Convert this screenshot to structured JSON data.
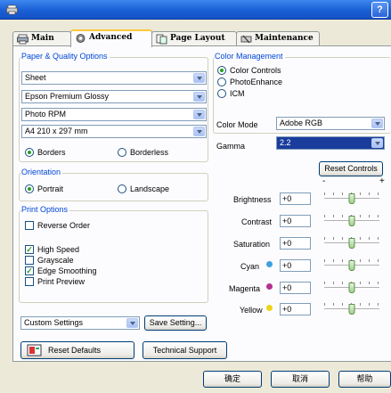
{
  "window": {
    "help_label": "?"
  },
  "tabs": [
    {
      "label": "Main",
      "icon": "printer-icon"
    },
    {
      "label": "Advanced",
      "icon": "gear-icon"
    },
    {
      "label": "Page Layout",
      "icon": "page-layout-icon"
    },
    {
      "label": "Maintenance",
      "icon": "maintenance-icon"
    }
  ],
  "paper_quality": {
    "title": "Paper & Quality Options",
    "source": "Sheet",
    "media_type": "Epson Premium Glossy",
    "quality": "Photo RPM",
    "size": "A4 210 x 297 mm",
    "borders_label": "Borders",
    "borderless_label": "Borderless",
    "selected": "Borders"
  },
  "orientation": {
    "title": "Orientation",
    "portrait_label": "Portrait",
    "landscape_label": "Landscape",
    "selected": "Portrait"
  },
  "print_options": {
    "title": "Print Options",
    "items": [
      {
        "label": "Reverse Order",
        "checked": false
      },
      {
        "label": "High Speed",
        "checked": true
      },
      {
        "label": "Grayscale",
        "checked": false
      },
      {
        "label": "Edge Smoothing",
        "checked": true
      },
      {
        "label": "Print Preview",
        "checked": false
      }
    ]
  },
  "custom": {
    "select_value": "Custom Settings",
    "save_label": "Save Setting..."
  },
  "bottom_buttons": {
    "reset_defaults": "Reset Defaults",
    "technical_support": "Technical Support"
  },
  "color_management": {
    "title": "Color Management",
    "options": [
      "Color Controls",
      "PhotoEnhance",
      "ICM"
    ],
    "selected": "Color Controls",
    "color_mode_label": "Color Mode",
    "color_mode_value": "Adobe RGB",
    "gamma_label": "Gamma",
    "gamma_value": "2.2",
    "reset_controls_label": "Reset Controls",
    "minus": "-",
    "plus": "+"
  },
  "adjustments": [
    {
      "label": "Brightness",
      "value": "+0",
      "position": 0.5,
      "dot_color": ""
    },
    {
      "label": "Contrast",
      "value": "+0",
      "position": 0.5,
      "dot_color": ""
    },
    {
      "label": "Saturation",
      "value": "+0",
      "position": 0.5,
      "dot_color": ""
    },
    {
      "label": "Cyan",
      "value": "+0",
      "position": 0.5,
      "dot_color": "#3ea0dd"
    },
    {
      "label": "Magenta",
      "value": "+0",
      "position": 0.5,
      "dot_color": "#b2338f"
    },
    {
      "label": "Yellow",
      "value": "+0",
      "position": 0.5,
      "dot_color": "#ead51a"
    }
  ],
  "dialog_buttons": {
    "ok": "确定",
    "cancel": "取消",
    "help": "帮助"
  }
}
